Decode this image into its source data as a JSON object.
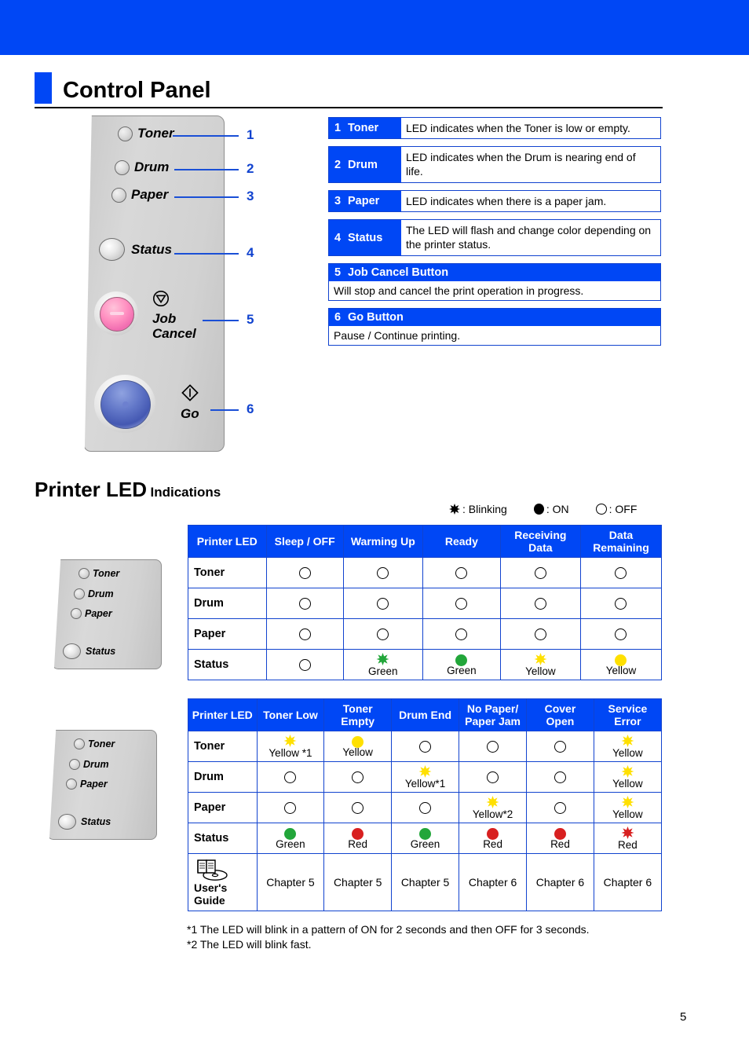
{
  "page": {
    "title": "Control Panel",
    "page_number": "5",
    "accent_blue": "#0047f5",
    "border_blue": "#1143cf"
  },
  "panel_illustration": {
    "leds": [
      {
        "label": "Toner",
        "size": "small"
      },
      {
        "label": "Drum",
        "size": "small"
      },
      {
        "label": "Paper",
        "size": "small"
      },
      {
        "label": "Status",
        "size": "large"
      }
    ],
    "buttons": [
      {
        "label_line1": "Job",
        "label_line2": "Cancel",
        "icon": "stop-triangle-circle-icon",
        "color": "#ff8ec0"
      },
      {
        "label_line1": "Go",
        "label_line2": "",
        "icon": "go-diamond-icon",
        "color": "#4458b2"
      }
    ],
    "callout_numbers": [
      "1",
      "2",
      "3",
      "4",
      "5",
      "6"
    ]
  },
  "descriptions": [
    {
      "num": "1",
      "key": "Toner",
      "value": "LED indicates when the Toner is low or empty.",
      "stacked": false
    },
    {
      "num": "2",
      "key": "Drum",
      "value": "LED indicates when the Drum is nearing end of life.",
      "stacked": false
    },
    {
      "num": "3",
      "key": "Paper",
      "value": "LED indicates when there is a paper jam.",
      "stacked": false
    },
    {
      "num": "4",
      "key": "Status",
      "value": "The LED will flash and change color depending on the printer status.",
      "stacked": false
    },
    {
      "num": "5",
      "key": "Job Cancel Button",
      "value": "Will stop and cancel the print operation in progress.",
      "stacked": true
    },
    {
      "num": "6",
      "key": "Go Button",
      "value": "Pause / Continue printing.",
      "stacked": true
    }
  ],
  "led_section": {
    "heading_big": "Printer LED",
    "heading_small": "Indications",
    "legend": [
      {
        "symbol": "blinking-star-icon",
        "text": ": Blinking"
      },
      {
        "symbol": "on-filled-circle-icon",
        "text": ": ON"
      },
      {
        "symbol": "off-empty-circle-icon",
        "text": ": OFF"
      }
    ]
  },
  "table1": {
    "headers": [
      "Printer LED",
      "Sleep / OFF",
      "Warming Up",
      "Ready",
      "Receiving Data",
      "Data Remaining"
    ],
    "rows": [
      {
        "name": "Toner",
        "cells": [
          {
            "state": "off",
            "caption": ""
          },
          {
            "state": "off",
            "caption": ""
          },
          {
            "state": "off",
            "caption": ""
          },
          {
            "state": "off",
            "caption": ""
          },
          {
            "state": "off",
            "caption": ""
          }
        ]
      },
      {
        "name": "Drum",
        "cells": [
          {
            "state": "off",
            "caption": ""
          },
          {
            "state": "off",
            "caption": ""
          },
          {
            "state": "off",
            "caption": ""
          },
          {
            "state": "off",
            "caption": ""
          },
          {
            "state": "off",
            "caption": ""
          }
        ]
      },
      {
        "name": "Paper",
        "cells": [
          {
            "state": "off",
            "caption": ""
          },
          {
            "state": "off",
            "caption": ""
          },
          {
            "state": "off",
            "caption": ""
          },
          {
            "state": "off",
            "caption": ""
          },
          {
            "state": "off",
            "caption": ""
          }
        ]
      },
      {
        "name": "Status",
        "cells": [
          {
            "state": "off",
            "caption": ""
          },
          {
            "state": "blink",
            "color": "#22a63a",
            "caption": "Green"
          },
          {
            "state": "on",
            "color": "#22a63a",
            "caption": "Green"
          },
          {
            "state": "blink",
            "color": "#ffe000",
            "caption": "Yellow"
          },
          {
            "state": "on",
            "color": "#ffe000",
            "caption": "Yellow"
          }
        ]
      }
    ]
  },
  "table2": {
    "headers": [
      "Printer LED",
      "Toner Low",
      "Toner Empty",
      "Drum End",
      "No Paper/ Paper Jam",
      "Cover Open",
      "Service Error"
    ],
    "rows": [
      {
        "name": "Toner",
        "cells": [
          {
            "state": "blink",
            "color": "#ffe000",
            "caption": "Yellow *1"
          },
          {
            "state": "on",
            "color": "#ffe000",
            "caption": "Yellow"
          },
          {
            "state": "off",
            "caption": ""
          },
          {
            "state": "off",
            "caption": ""
          },
          {
            "state": "off",
            "caption": ""
          },
          {
            "state": "blink",
            "color": "#ffe000",
            "caption": "Yellow"
          }
        ]
      },
      {
        "name": "Drum",
        "cells": [
          {
            "state": "off",
            "caption": ""
          },
          {
            "state": "off",
            "caption": ""
          },
          {
            "state": "blink",
            "color": "#ffe000",
            "caption": "Yellow*1"
          },
          {
            "state": "off",
            "caption": ""
          },
          {
            "state": "off",
            "caption": ""
          },
          {
            "state": "blink",
            "color": "#ffe000",
            "caption": "Yellow"
          }
        ]
      },
      {
        "name": "Paper",
        "cells": [
          {
            "state": "off",
            "caption": ""
          },
          {
            "state": "off",
            "caption": ""
          },
          {
            "state": "off",
            "caption": ""
          },
          {
            "state": "blink",
            "color": "#ffe000",
            "caption": "Yellow*2"
          },
          {
            "state": "off",
            "caption": ""
          },
          {
            "state": "blink",
            "color": "#ffe000",
            "caption": "Yellow"
          }
        ]
      },
      {
        "name": "Status",
        "cells": [
          {
            "state": "on",
            "color": "#22a63a",
            "caption": "Green"
          },
          {
            "state": "on",
            "color": "#d82020",
            "caption": "Red"
          },
          {
            "state": "on",
            "color": "#22a63a",
            "caption": "Green"
          },
          {
            "state": "on",
            "color": "#d82020",
            "caption": "Red"
          },
          {
            "state": "on",
            "color": "#d82020",
            "caption": "Red"
          },
          {
            "state": "blink",
            "color": "#d82020",
            "caption": "Red"
          }
        ]
      }
    ],
    "guide_row": {
      "icon": "users-guide-book-cd-icon",
      "label_line1": "User's",
      "label_line2": "Guide",
      "chapters": [
        "Chapter 5",
        "Chapter 5",
        "Chapter 5",
        "Chapter 6",
        "Chapter 6",
        "Chapter 6"
      ]
    }
  },
  "footnotes": [
    "*1 The LED will blink in a pattern of ON for 2 seconds and then OFF for 3 seconds.",
    "*2 The LED will blink fast."
  ]
}
